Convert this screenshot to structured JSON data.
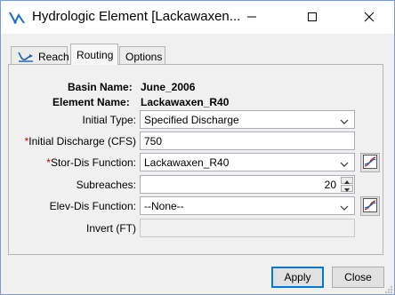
{
  "window": {
    "title": "Hydrologic Element [Lackawaxen..."
  },
  "icons": {
    "app": "hydrologic-element-icon",
    "minimize": "minimize-icon",
    "maximize": "maximize-icon",
    "close": "close-icon",
    "reach_tab": "reach-icon",
    "dropdown": "chevron-down-icon",
    "plot": "plot-icon",
    "spin_up": "spin-up-icon",
    "spin_down": "spin-down-icon"
  },
  "tabs": [
    {
      "label": "Reach",
      "active": false
    },
    {
      "label": "Routing",
      "active": true
    },
    {
      "label": "Options",
      "active": false
    }
  ],
  "header": {
    "basin_label": "Basin Name:",
    "basin_value": "June_2006",
    "element_label": "Element Name:",
    "element_value": "Lackawaxen_R40"
  },
  "form": {
    "initial_type": {
      "label": "Initial Type:",
      "value": "Specified Discharge"
    },
    "initial_discharge": {
      "required_mark": "*",
      "label": "Initial Discharge (CFS)",
      "value": "750"
    },
    "stor_dis": {
      "required_mark": "*",
      "label": "Stor-Dis Function:",
      "value": "Lackawaxen_R40"
    },
    "subreaches": {
      "label": "Subreaches:",
      "value": "20"
    },
    "elev_dis": {
      "label": "Elev-Dis Function:",
      "value": "--None--"
    },
    "invert": {
      "label": "Invert (FT)",
      "value": ""
    }
  },
  "buttons": {
    "apply": "Apply",
    "close": "Close"
  },
  "colors": {
    "window_border": "#7a9ad4",
    "required": "#cc0000",
    "default_button": "#0078d7"
  }
}
